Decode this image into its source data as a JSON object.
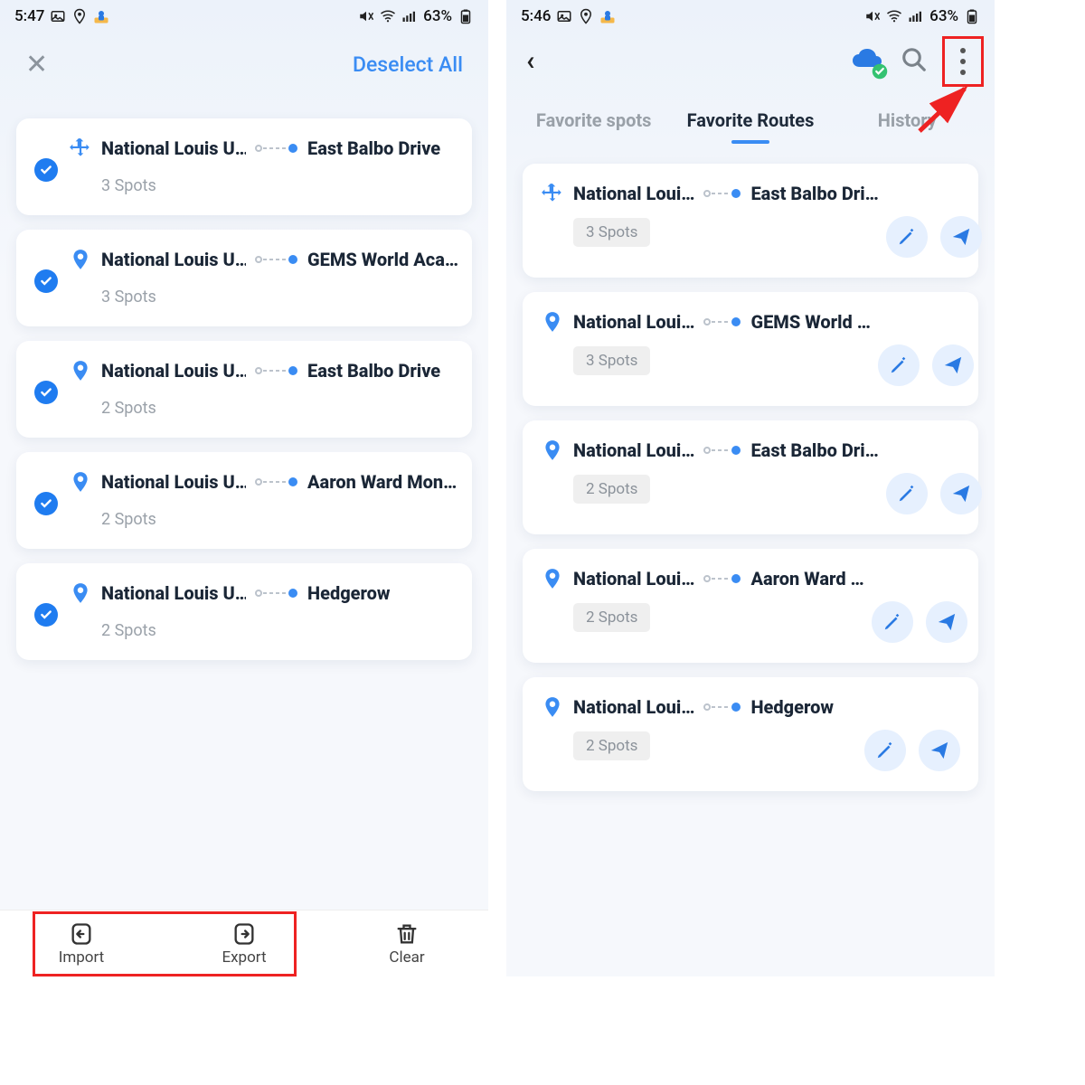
{
  "status_left": {
    "time": "5:47",
    "battery": "63%"
  },
  "status_right": {
    "time": "5:46",
    "battery": "63%"
  },
  "left_header": {
    "deselect": "Deselect All"
  },
  "tabs": {
    "spots": "Favorite spots",
    "routes": "Favorite Routes",
    "history": "History"
  },
  "bottom": {
    "import": "Import",
    "export": "Export",
    "clear": "Clear"
  },
  "icons": {
    "move": "move-icon",
    "pin": "pin-icon"
  },
  "routes_left": [
    {
      "icon": "move",
      "from": "National Louis U…",
      "to": "East Balbo Drive",
      "spots": "3 Spots"
    },
    {
      "icon": "pin",
      "from": "National Louis U…",
      "to": "GEMS World Aca…",
      "spots": "3 Spots"
    },
    {
      "icon": "pin",
      "from": "National Louis U…",
      "to": "East Balbo Drive",
      "spots": "2 Spots"
    },
    {
      "icon": "pin",
      "from": "National Louis U…",
      "to": "Aaron Ward Mon…",
      "spots": "2 Spots"
    },
    {
      "icon": "pin",
      "from": "National Louis U…",
      "to": "Hedgerow",
      "spots": "2 Spots"
    }
  ],
  "routes_right": [
    {
      "icon": "move",
      "from": "National Loui…",
      "to": "East Balbo Dri…",
      "spots": "3 Spots"
    },
    {
      "icon": "pin",
      "from": "National Loui…",
      "to": "GEMS World …",
      "spots": "3 Spots"
    },
    {
      "icon": "pin",
      "from": "National Loui…",
      "to": "East Balbo Dri…",
      "spots": "2 Spots"
    },
    {
      "icon": "pin",
      "from": "National Loui…",
      "to": "Aaron Ward …",
      "spots": "2 Spots"
    },
    {
      "icon": "pin",
      "from": "National Loui…",
      "to": "Hedgerow",
      "spots": "2 Spots"
    }
  ]
}
